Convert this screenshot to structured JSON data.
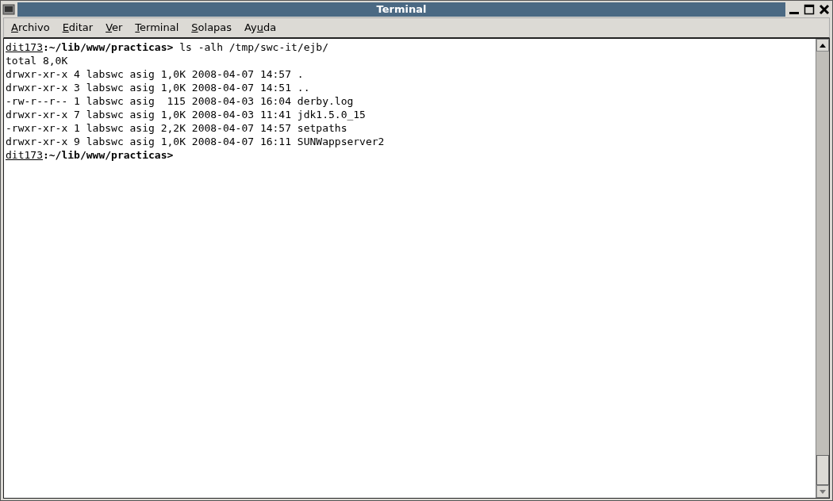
{
  "window": {
    "title": "Terminal"
  },
  "menu": [
    {
      "parts": [
        {
          "text": "A",
          "underlined": true
        },
        {
          "text": "rchivo",
          "underlined": false
        }
      ]
    },
    {
      "parts": [
        {
          "text": "E",
          "underlined": true
        },
        {
          "text": "ditar",
          "underlined": false
        }
      ]
    },
    {
      "parts": [
        {
          "text": "V",
          "underlined": true
        },
        {
          "text": "er",
          "underlined": false
        }
      ]
    },
    {
      "parts": [
        {
          "text": "T",
          "underlined": true
        },
        {
          "text": "erminal",
          "underlined": false
        }
      ]
    },
    {
      "parts": [
        {
          "text": "S",
          "underlined": true
        },
        {
          "text": "olapas",
          "underlined": false
        }
      ]
    },
    {
      "parts": [
        {
          "text": "Ay",
          "underlined": false
        },
        {
          "text": "u",
          "underlined": true
        },
        {
          "text": "da",
          "underlined": false
        }
      ]
    }
  ],
  "terminal": {
    "lines": [
      {
        "kind": "prompt",
        "user": "dit173",
        "path": ":~/lib/www/practicas>",
        "command": " ls -alh /tmp/swc-it/ejb/"
      },
      {
        "kind": "output",
        "text": "total 8,0K"
      },
      {
        "kind": "output",
        "text": "drwxr-xr-x 4 labswc asig 1,0K 2008-04-07 14:57 ."
      },
      {
        "kind": "output",
        "text": "drwxr-xr-x 3 labswc asig 1,0K 2008-04-07 14:51 .."
      },
      {
        "kind": "output",
        "text": "-rw-r--r-- 1 labswc asig  115 2008-04-03 16:04 derby.log"
      },
      {
        "kind": "output",
        "text": "drwxr-xr-x 7 labswc asig 1,0K 2008-04-03 11:41 jdk1.5.0_15"
      },
      {
        "kind": "output",
        "text": "-rwxr-xr-x 1 labswc asig 2,2K 2008-04-07 14:57 setpaths"
      },
      {
        "kind": "output",
        "text": "drwxr-xr-x 9 labswc asig 1,0K 2008-04-07 16:11 SUNWappserver2"
      },
      {
        "kind": "prompt",
        "user": "dit173",
        "path": ":~/lib/www/practicas>"
      }
    ]
  }
}
